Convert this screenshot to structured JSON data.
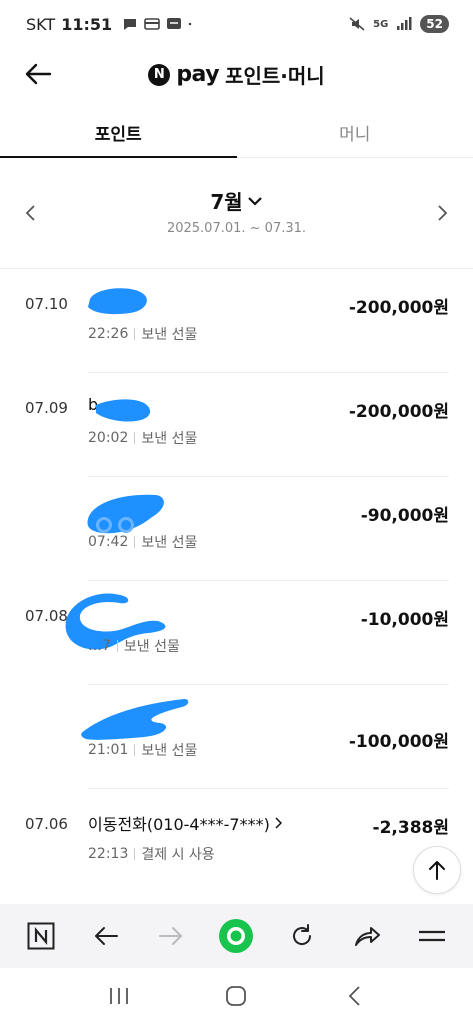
{
  "status_bar": {
    "carrier": "SKT",
    "time": "11:51",
    "battery": "52",
    "network": "5G"
  },
  "header": {
    "logo_letter": "N",
    "pay_text": "pay",
    "title": "포인트·머니"
  },
  "tabs": [
    {
      "label": "포인트",
      "active": true
    },
    {
      "label": "머니",
      "active": false
    }
  ],
  "month": {
    "label": "7월",
    "range": "2025.07.01. ~ 07.31."
  },
  "transactions": [
    {
      "date": "07.10",
      "name": "",
      "time": "22:26",
      "type": "보낸 선물",
      "amount": "-200,000원"
    },
    {
      "date": "07.09",
      "name": "b",
      "time": "20:02",
      "type": "보낸 선물",
      "amount": "-200,000원"
    },
    {
      "date": "",
      "name": "",
      "time": "07:42",
      "type": "보낸 선물",
      "amount": "-90,000원"
    },
    {
      "date": "07.08",
      "name": "",
      "time": "…7",
      "type": "보낸 선물",
      "amount": "-10,000원"
    },
    {
      "date": "",
      "name": "",
      "time": "21:01",
      "type": "보낸 선물",
      "amount": "-100,000원"
    },
    {
      "date": "07.06",
      "name": "이동전화(010-4***-7***)",
      "time": "22:13",
      "type": "결제 시 사용",
      "amount": "-2,388원"
    }
  ],
  "colors": {
    "accent": "#18c44e",
    "redaction": "#1e90ff",
    "text_primary": "#111111",
    "text_secondary": "#666666"
  }
}
